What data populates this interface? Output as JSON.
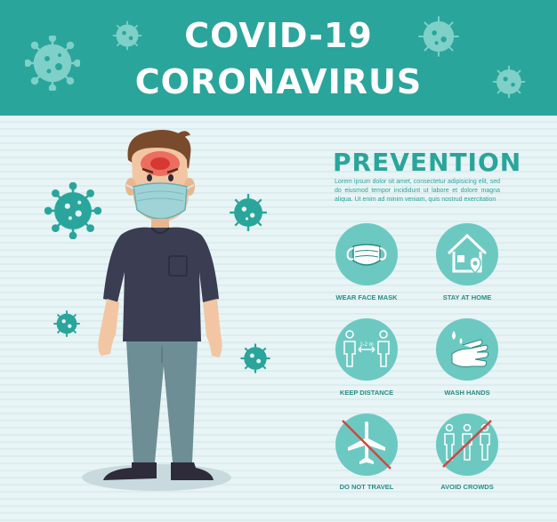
{
  "header": {
    "title_line1": "COVID-19",
    "title_line2": "CORONAVIRUS"
  },
  "prevention": {
    "title": "PREVENTION",
    "body": "Lorem ipsum dolor sit amet, consectetur adipisicing elit, sed do eiusmod tempor incididunt ut labore et dolore magna aliqua. Ut enim ad minim veniam,  quis nostrud  exercitation"
  },
  "tips": [
    {
      "label": "WEAR  FACE MASK",
      "icon": "face-mask-icon"
    },
    {
      "label": "STAY AT HOME",
      "icon": "house-icon"
    },
    {
      "label": "KEEP DISTANCE",
      "icon": "distance-icon",
      "distance_text": "1-2 m"
    },
    {
      "label": "WASH  HANDS",
      "icon": "wash-hands-icon"
    },
    {
      "label": "DO NOT TRAVEL",
      "icon": "no-airplane-icon"
    },
    {
      "label": "AVOID CROWDS",
      "icon": "no-crowd-icon"
    }
  ],
  "colors": {
    "primary": "#2aa59b",
    "circle": "#6cc9c2",
    "background": "#e6f3f4",
    "forbid": "#d7453e"
  }
}
